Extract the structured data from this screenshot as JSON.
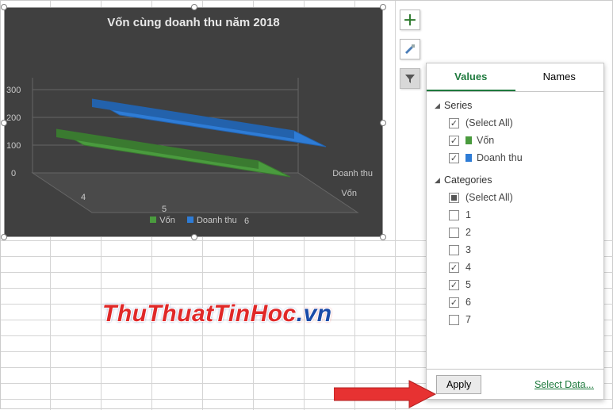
{
  "chart_data": {
    "type": "bar",
    "title": "Vốn cùng doanh thu năm 2018",
    "categories": [
      "4",
      "5",
      "6"
    ],
    "series": [
      {
        "name": "Vốn",
        "values": [
          200,
          200,
          200
        ],
        "color": "#4a9b3e"
      },
      {
        "name": "Doanh thu",
        "values": [
          250,
          250,
          250
        ],
        "color": "#2e7cd6"
      }
    ],
    "ylim": [
      0,
      300
    ],
    "y_ticks": [
      0,
      100,
      200,
      300
    ],
    "z_labels": [
      "Vốn",
      "Doanh thu"
    ],
    "style": "3d-area"
  },
  "axis": {
    "y0": "0",
    "y1": "100",
    "y2": "200",
    "y3": "300",
    "x1": "4",
    "x2": "5",
    "x3": "6",
    "zv": "Vốn",
    "zd": "Doanh thu"
  },
  "legend": {
    "s1": "Vốn",
    "s2": "Doanh thu"
  },
  "side_buttons": {
    "plus": "＋"
  },
  "panel": {
    "tabs": {
      "values": "Values",
      "names": "Names"
    },
    "series_header": "Series",
    "categories_header": "Categories",
    "select_all": "(Select All)",
    "series": [
      {
        "label": "Vốn",
        "color": "#4a9b3e",
        "checked": true
      },
      {
        "label": "Doanh thu",
        "color": "#2e7cd6",
        "checked": true
      }
    ],
    "categories": [
      {
        "label": "1",
        "checked": false
      },
      {
        "label": "2",
        "checked": false
      },
      {
        "label": "3",
        "checked": false
      },
      {
        "label": "4",
        "checked": true
      },
      {
        "label": "5",
        "checked": true
      },
      {
        "label": "6",
        "checked": true
      },
      {
        "label": "7",
        "checked": false
      }
    ],
    "apply": "Apply",
    "select_data": "Select Data..."
  },
  "watermark": {
    "a": "ThuThuatTinHoc",
    "b": ".vn"
  }
}
